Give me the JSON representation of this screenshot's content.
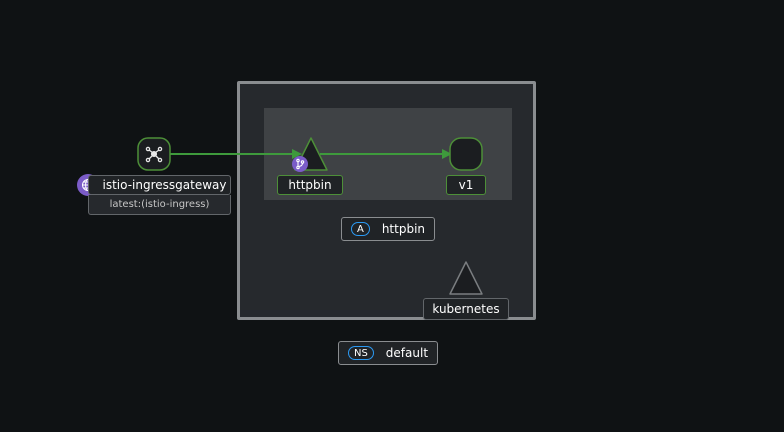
{
  "graph": {
    "namespace": {
      "badge": "NS",
      "name": "default"
    },
    "app": {
      "badge": "A",
      "name": "httpbin"
    },
    "nodes": {
      "gateway": {
        "name": "istio-ingressgateway",
        "version": "latest:(istio-ingress)",
        "icon": "network-gateway-icon"
      },
      "service": {
        "name": "httpbin",
        "icon": "service-triangle-icon"
      },
      "workload": {
        "name": "v1",
        "icon": "workload-rect-icon"
      },
      "kubernetes": {
        "name": "kubernetes",
        "icon": "service-triangle-icon"
      }
    },
    "colors": {
      "edge": "#3e9a3c",
      "node_border": "#4d8f38",
      "badge_purple": "#7b5cc8",
      "pill_blue": "#2b9af3"
    }
  }
}
